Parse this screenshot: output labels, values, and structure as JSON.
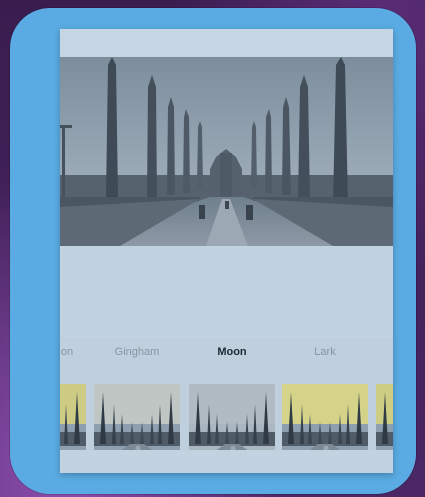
{
  "filters": {
    "items": [
      {
        "label": "on",
        "tint": "#d9d27c"
      },
      {
        "label": "Gingham",
        "tint": "#c8ccc8"
      },
      {
        "label": "Moon",
        "tint": "#b9c3ca",
        "selected": true
      },
      {
        "label": "Lark",
        "tint": "#e1dc82"
      },
      {
        "label": "",
        "tint": "#d8d57c"
      }
    ]
  },
  "colors": {
    "device_frame": "#5aabe3",
    "screen_bg": "#c3d3e1",
    "selected_label": "#1d2a35",
    "unselected_label": "#8795a2"
  },
  "icons": {
    "preview": "cathedral-rooftop-photo"
  }
}
